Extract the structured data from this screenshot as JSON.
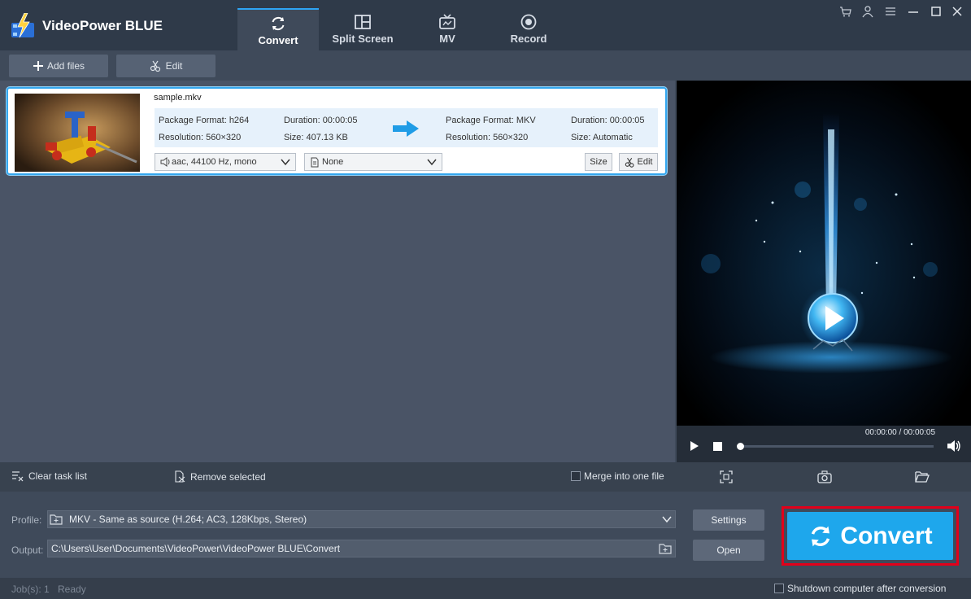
{
  "app": {
    "title": "VideoPower BLUE",
    "accent_color": "#2ea3f2",
    "convert_color": "#1ea7ec",
    "highlight_color": "#e2001a"
  },
  "tabs": [
    {
      "label": "Convert",
      "icon": "refresh-icon",
      "active": true
    },
    {
      "label": "Split Screen",
      "icon": "split-screen-icon",
      "active": false
    },
    {
      "label": "MV",
      "icon": "tv-icon",
      "active": false
    },
    {
      "label": "Record",
      "icon": "record-icon",
      "active": false
    }
  ],
  "window_controls": [
    "cart-icon",
    "user-icon",
    "menu-icon",
    "minimize-icon",
    "maximize-icon",
    "close-icon"
  ],
  "toolbar": {
    "add_files": "Add files",
    "edit": "Edit"
  },
  "file": {
    "name": "sample.mkv",
    "source": {
      "format": "Package Format: h264",
      "resolution": "Resolution: 560×320",
      "duration": "Duration: 00:00:05",
      "size": "Size: 407.13 KB"
    },
    "target": {
      "format": "Package Format: MKV",
      "resolution": "Resolution: 560×320",
      "duration": "Duration: 00:00:05",
      "size": "Size: Automatic"
    },
    "audio_track": "aac, 44100 Hz, mono",
    "subtitle": "None",
    "size_button": "Size",
    "edit_button": "Edit"
  },
  "player": {
    "timecode": "00:00:00 / 00:00:05",
    "progress": 0
  },
  "tasks": {
    "clear": "Clear task list",
    "remove": "Remove selected",
    "merge": "Merge into one file",
    "merge_checked": false
  },
  "output": {
    "profile_label": "Profile:",
    "profile_value": "MKV - Same as source (H.264; AC3, 128Kbps, Stereo)",
    "output_label": "Output:",
    "output_value": "C:\\Users\\User\\Documents\\VideoPower\\VideoPower BLUE\\Convert",
    "settings": "Settings",
    "open": "Open",
    "convert": "Convert"
  },
  "status": {
    "jobs": "Job(s): 1",
    "state": "Ready",
    "shutdown": "Shutdown computer after conversion",
    "shutdown_checked": false
  }
}
